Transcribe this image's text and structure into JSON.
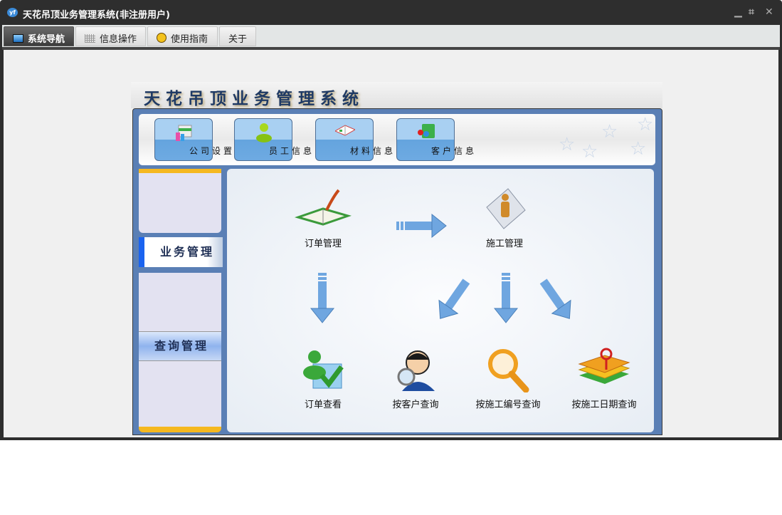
{
  "window": {
    "title": "天花吊顶业务管理系统(非注册用户)",
    "logo": "yf"
  },
  "menu_tabs": [
    {
      "label": "系统导航",
      "icon": "monitor-icon"
    },
    {
      "label": "信息操作",
      "icon": "grid-icon"
    },
    {
      "label": "使用指南",
      "icon": "help-icon"
    },
    {
      "label": "关于"
    }
  ],
  "app": {
    "title": "天花吊顶业务管理系统",
    "toolbar": [
      {
        "label": "公司设置",
        "icon": "company-icon"
      },
      {
        "label": "员工信息",
        "icon": "user-icon"
      },
      {
        "label": "材料信息",
        "icon": "book-icon"
      },
      {
        "label": "客户信息",
        "icon": "customer-icon"
      }
    ],
    "sidebar": [
      {
        "label": "业务管理",
        "active": true
      },
      {
        "label": "查询管理",
        "active": false
      }
    ],
    "flow": {
      "order_mgmt": "订单管理",
      "construction_mgmt": "施工管理",
      "order_view": "订单查看",
      "by_customer": "按客户查询",
      "by_construction_no": "按施工编号查询",
      "by_construction_date": "按施工日期查询"
    }
  },
  "colors": {
    "titlebar": "#2e2e2e",
    "frame": "#5a7fb5",
    "arrow": "#6fa6e0",
    "accent": "#1a63f0"
  }
}
